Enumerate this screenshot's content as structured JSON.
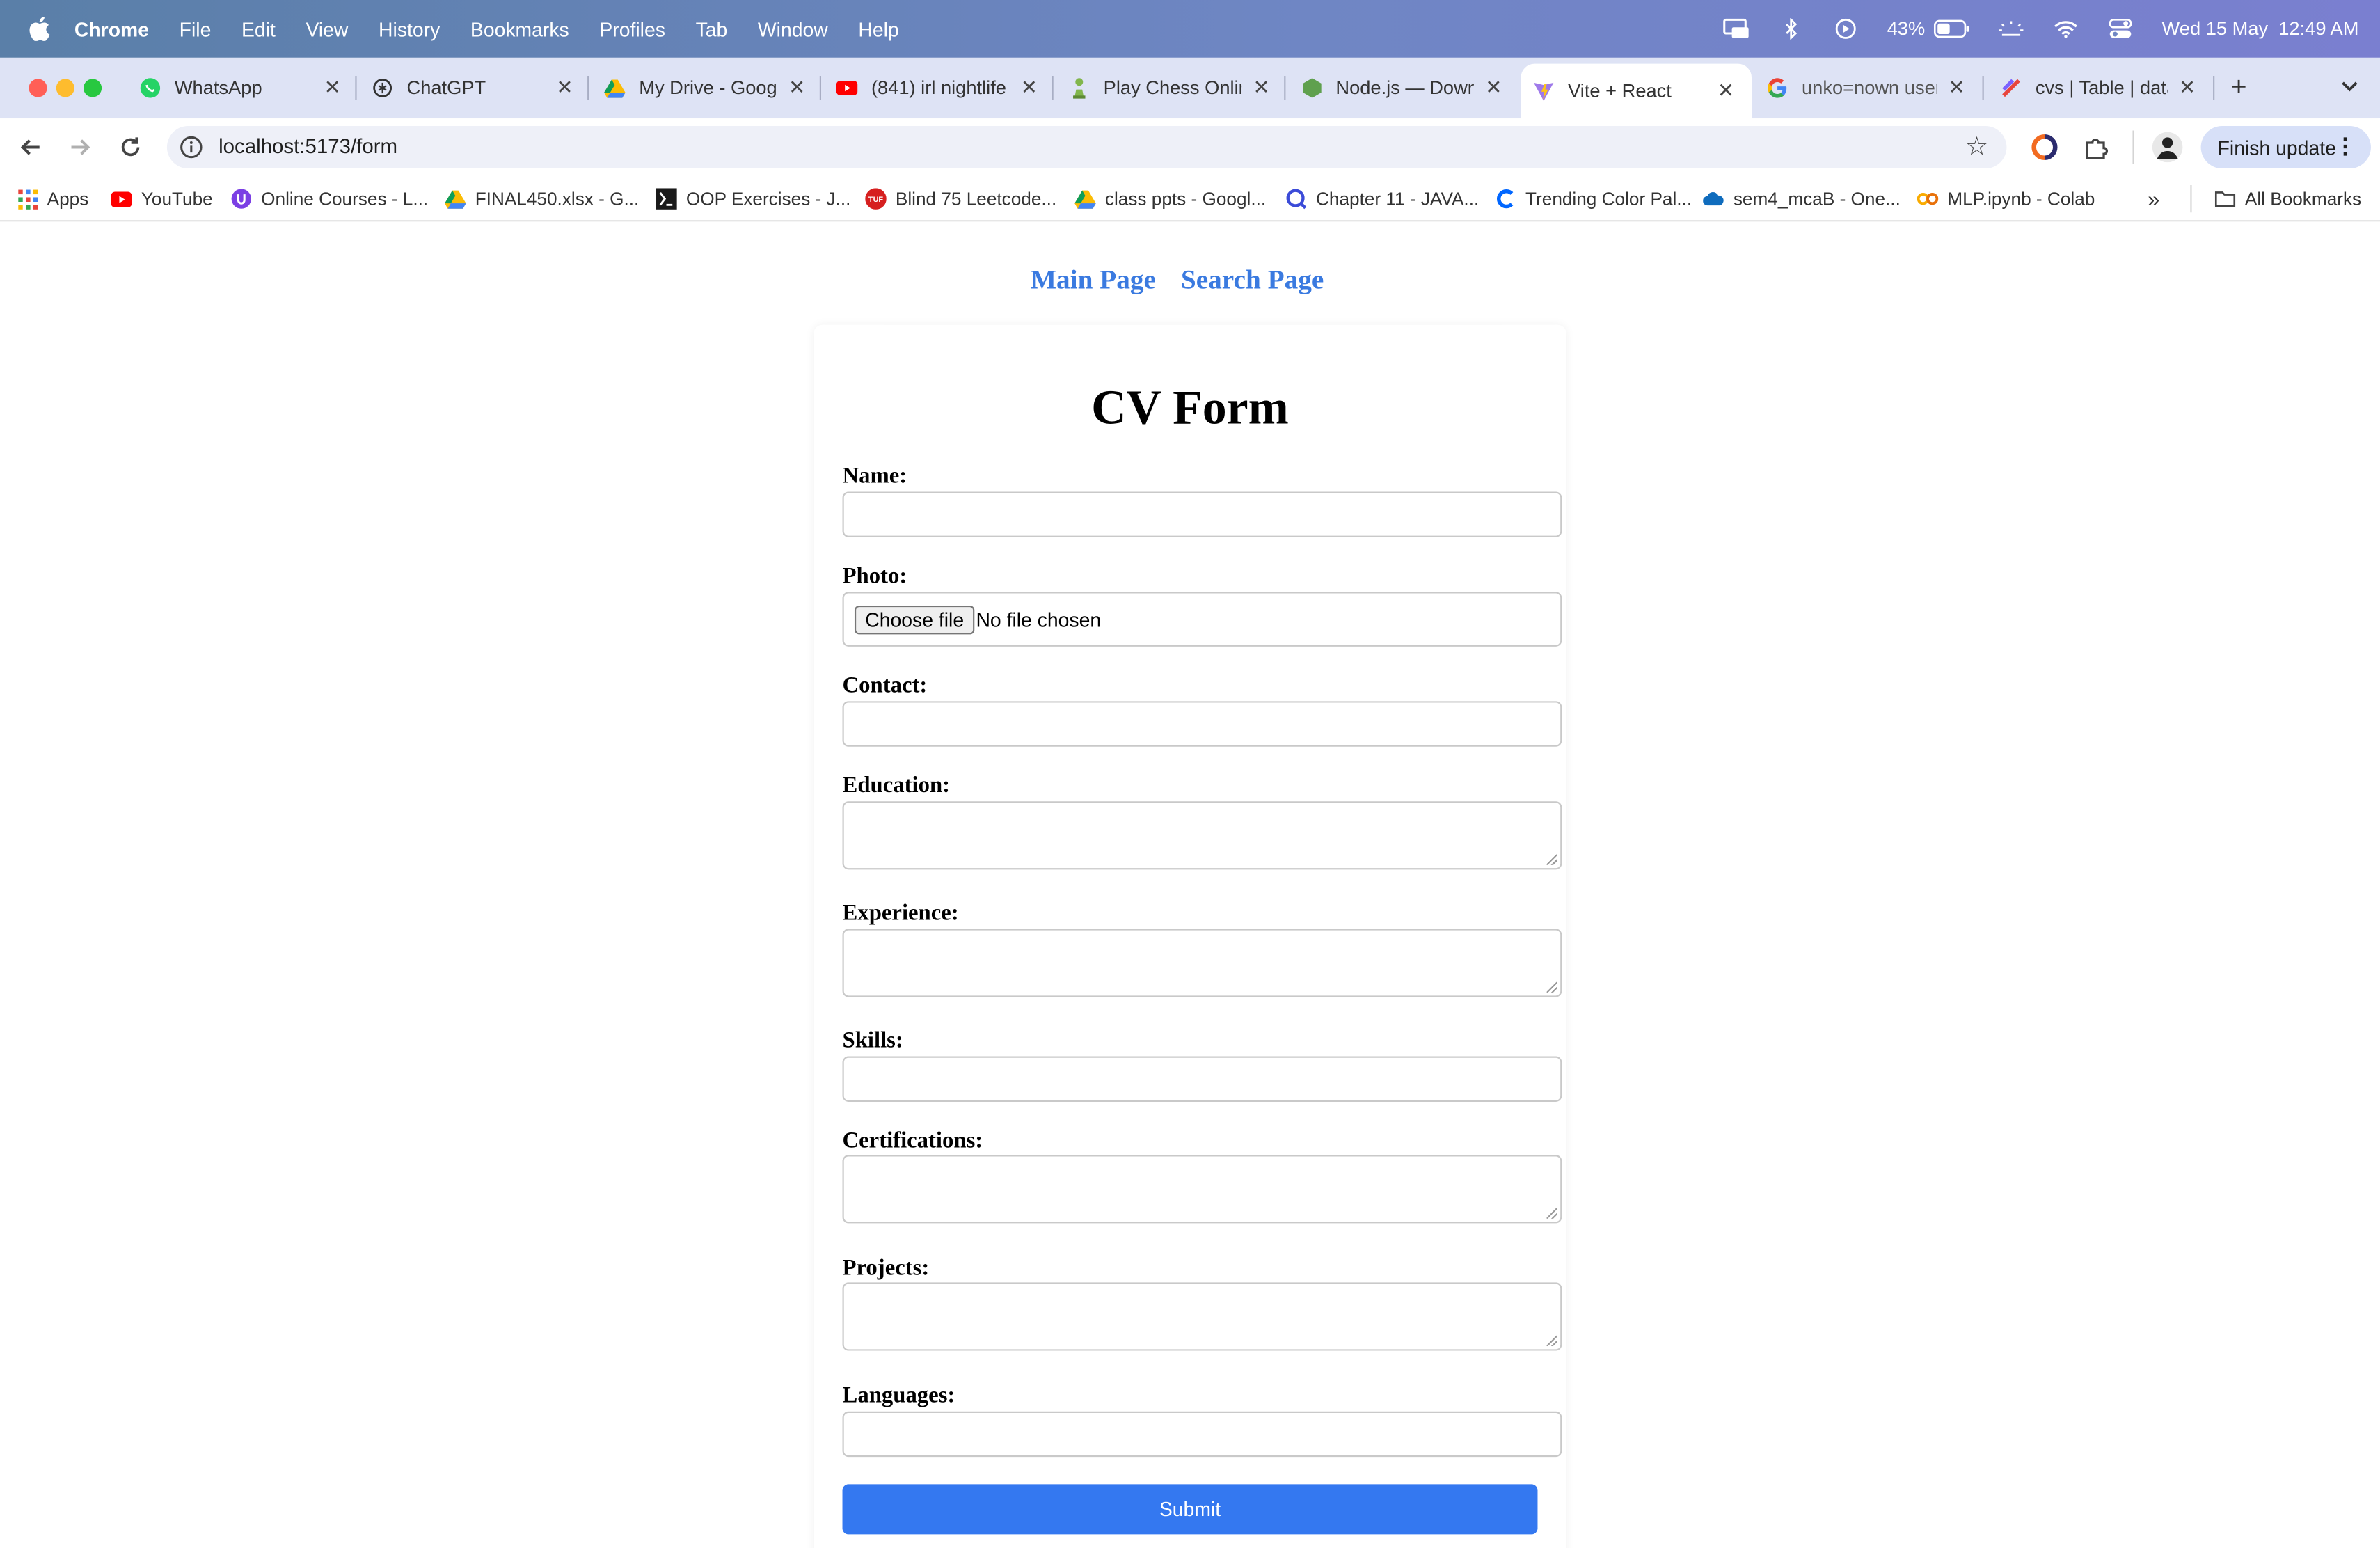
{
  "menubar": {
    "app_name": "Chrome",
    "items": [
      "File",
      "Edit",
      "View",
      "History",
      "Bookmarks",
      "Profiles",
      "Tab",
      "Window",
      "Help"
    ],
    "battery_percent": "43%",
    "datetime": "Wed 15 May  12:49 AM"
  },
  "tabs": [
    {
      "title": "WhatsApp",
      "icon": "whatsapp-icon"
    },
    {
      "title": "ChatGPT",
      "icon": "chatgpt-icon"
    },
    {
      "title": "My Drive - Googl",
      "icon": "google-drive-icon"
    },
    {
      "title": "(841) irl nightlife",
      "icon": "youtube-icon"
    },
    {
      "title": "Play Chess Onlin",
      "icon": "chess-icon"
    },
    {
      "title": "Node.js — Downl",
      "icon": "nodejs-icon"
    },
    {
      "title": "Vite + React",
      "icon": "vite-icon",
      "active": true
    },
    {
      "title": "unko=nown user",
      "icon": "google-icon"
    },
    {
      "title": "cvs | Table | data",
      "icon": "table-icon"
    }
  ],
  "toolbar": {
    "url": "localhost:5173/form",
    "finish_update_label": "Finish update"
  },
  "bookmarks": [
    {
      "label": "Apps",
      "icon": "apps-grid-icon"
    },
    {
      "label": "YouTube",
      "icon": "youtube-icon"
    },
    {
      "label": "Online Courses - L...",
      "icon": "course-icon"
    },
    {
      "label": "FINAL450.xlsx - G...",
      "icon": "google-drive-icon"
    },
    {
      "label": "OOP Exercises - J...",
      "icon": "terminal-icon"
    },
    {
      "label": "Blind 75 Leetcode...",
      "icon": "tuf-icon"
    },
    {
      "label": "class ppts - Googl...",
      "icon": "google-drive-icon"
    },
    {
      "label": "Chapter 11 - JAVA...",
      "icon": "search-q-icon"
    },
    {
      "label": "Trending Color Pal...",
      "icon": "coolors-icon"
    },
    {
      "label": "sem4_mcaB - One...",
      "icon": "onedrive-icon"
    },
    {
      "label": "MLP.ipynb - Colab",
      "icon": "colab-icon"
    }
  ],
  "all_bookmarks_label": "All Bookmarks",
  "page": {
    "nav": {
      "main": "Main Page",
      "search": "Search Page"
    },
    "form_title": "CV Form",
    "fields": {
      "name": {
        "label": "Name:",
        "value": ""
      },
      "photo": {
        "label": "Photo:",
        "button": "Choose file",
        "status": "No file chosen"
      },
      "contact": {
        "label": "Contact:",
        "value": ""
      },
      "education": {
        "label": "Education:",
        "value": ""
      },
      "experience": {
        "label": "Experience:",
        "value": ""
      },
      "skills": {
        "label": "Skills:",
        "value": ""
      },
      "certifications": {
        "label": "Certifications:",
        "value": ""
      },
      "projects": {
        "label": "Projects:",
        "value": ""
      },
      "languages": {
        "label": "Languages:",
        "value": ""
      }
    },
    "submit_label": "Submit"
  },
  "colors": {
    "accent_link": "#3a7ae0",
    "submit_button": "#3478f0",
    "tabstrip_bg": "#dee3f5"
  }
}
